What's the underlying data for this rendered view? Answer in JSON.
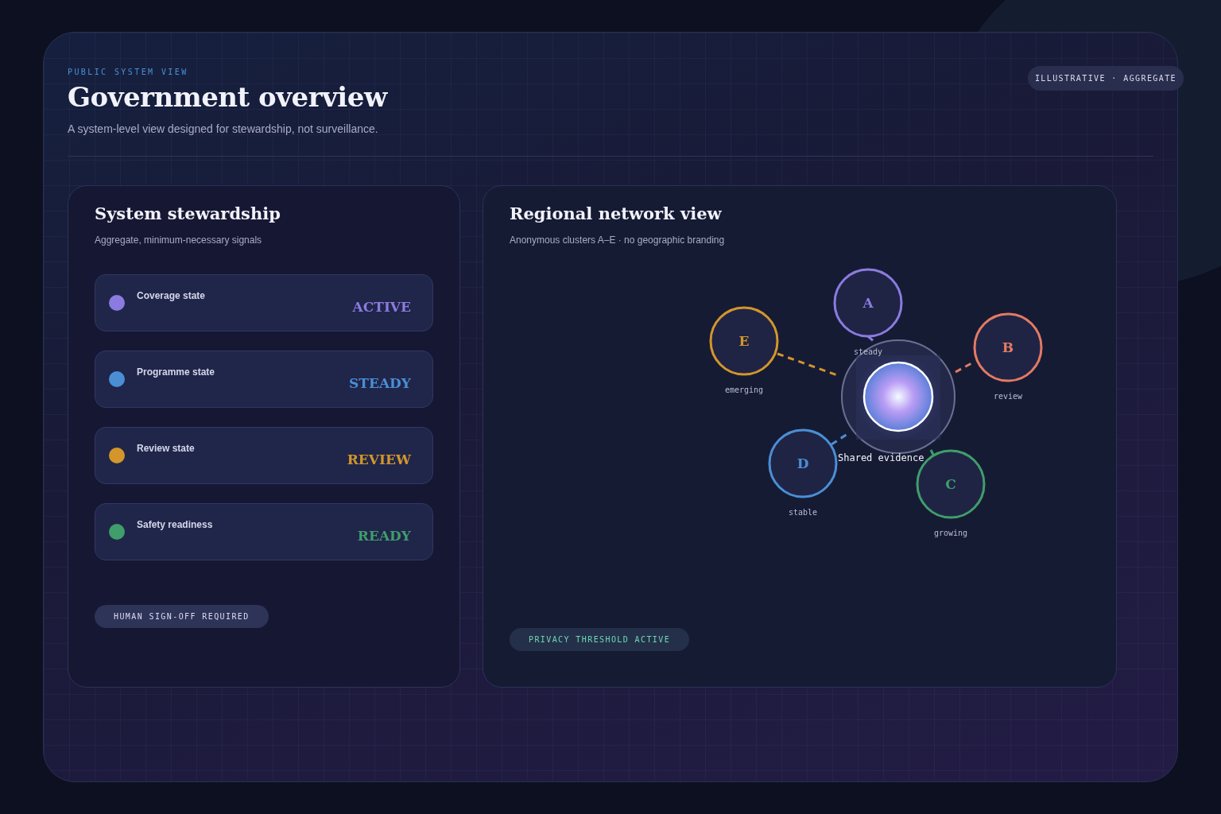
{
  "eyebrow": "PUBLIC SYSTEM VIEW",
  "title": "Government overview",
  "subtitle": "A system-level view designed for stewardship, not surveillance.",
  "badge": "ILLUSTRATIVE · AGGREGATE",
  "stewardship": {
    "title": "System stewardship",
    "subtitle": "Aggregate, minimum-necessary signals",
    "signals": [
      {
        "label": "Coverage state",
        "status": "ACTIVE",
        "color": "#8b7be0"
      },
      {
        "label": "Programme state",
        "status": "STEADY",
        "color": "#4a8fd6"
      },
      {
        "label": "Review state",
        "status": "REVIEW",
        "color": "#d4962a"
      },
      {
        "label": "Safety readiness",
        "status": "READY",
        "color": "#3f9e6a"
      }
    ],
    "footer_badge": "HUMAN SIGN-OFF REQUIRED"
  },
  "network": {
    "title": "Regional network view",
    "subtitle": "Anonymous clusters A–E · no geographic branding",
    "hub_label": "Shared evidence",
    "clusters": [
      {
        "letter": "A",
        "status": "steady",
        "color": "#8b7be0"
      },
      {
        "letter": "B",
        "status": "review",
        "color": "#e57a63"
      },
      {
        "letter": "C",
        "status": "growing",
        "color": "#3f9e6a"
      },
      {
        "letter": "D",
        "status": "stable",
        "color": "#4a8fd6"
      },
      {
        "letter": "E",
        "status": "emerging",
        "color": "#d4962a"
      }
    ],
    "footer_badge": "PRIVACY THRESHOLD ACTIVE"
  }
}
